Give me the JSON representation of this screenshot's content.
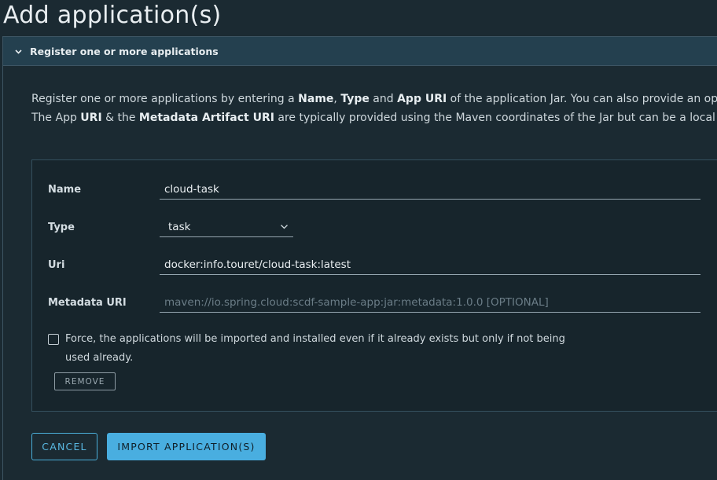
{
  "page": {
    "title": "Add application(s)"
  },
  "accordion": {
    "title": "Register one or more applications"
  },
  "intro": {
    "line1": {
      "t1": "Register one or more applications by entering a ",
      "b1": "Name",
      "t2": ", ",
      "b2": "Type",
      "t3": " and ",
      "b3": "App URI",
      "t4": " of the application Jar. You can also provide an optional"
    },
    "line2": {
      "t1": "The App ",
      "b1": "URI",
      "t2": " & the ",
      "b2": "Metadata Artifact URI",
      "t3": " are typically provided using the Maven coordinates of the Jar but can be a local file or a"
    }
  },
  "form": {
    "name": {
      "label": "Name",
      "value": "cloud-task"
    },
    "type": {
      "label": "Type",
      "value": "task"
    },
    "uri": {
      "label": "Uri",
      "value": "docker:info.touret/cloud-task:latest"
    },
    "metadata": {
      "label": "Metadata URI",
      "value": "",
      "placeholder": "maven://io.spring.cloud:scdf-sample-app:jar:metadata:1.0.0 [OPTIONAL]"
    },
    "force": {
      "label": "Force, the applications will be imported and installed even if it already exists but only if not being used already.",
      "checked": false
    },
    "remove_label": "REMOVE"
  },
  "actions": {
    "cancel_label": "CANCEL",
    "import_label": "IMPORT APPLICATION(S)"
  },
  "colors": {
    "accent": "#49aee0",
    "header_bg": "#24404f",
    "background": "#1b2a32"
  },
  "icons": {
    "accordion": "chevron-down-icon",
    "select": "chevron-down-icon"
  }
}
